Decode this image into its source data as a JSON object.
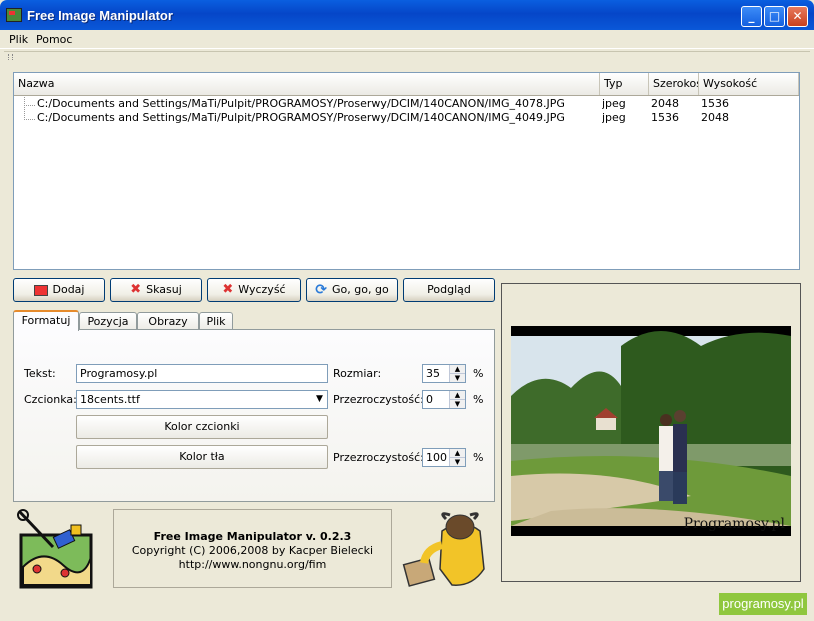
{
  "window": {
    "title": "Free Image Manipulator"
  },
  "menu": [
    "Plik",
    "Pomoc"
  ],
  "list": {
    "columns": [
      "Nazwa",
      "Typ",
      "Szerokość",
      "Wysokość"
    ],
    "rows": [
      {
        "name": "C:/Documents and Settings/MaTi/Pulpit/PROGRAMOSY/Proserwy/DCIM/140CANON/IMG_4078.JPG",
        "type": "jpeg",
        "width": "2048",
        "height": "1536"
      },
      {
        "name": "C:/Documents and Settings/MaTi/Pulpit/PROGRAMOSY/Proserwy/DCIM/140CANON/IMG_4049.JPG",
        "type": "jpeg",
        "width": "1536",
        "height": "2048"
      }
    ]
  },
  "buttons": {
    "add": "Dodaj",
    "delete": "Skasuj",
    "clear": "Wyczyść",
    "go": "Go, go, go",
    "preview": "Podgląd"
  },
  "tabs": [
    "Formatuj",
    "Pozycja",
    "Obrazy",
    "Plik"
  ],
  "format": {
    "text_label": "Tekst:",
    "text_value": "Programosy.pl",
    "font_label": "Czcionka:",
    "font_value": "18cents.ttf",
    "size_label": "Rozmiar:",
    "size_value": "35",
    "size_unit": "%",
    "font_opacity_label": "Przezroczystość:",
    "font_opacity_value": "0",
    "font_opacity_unit": "%",
    "font_color_button": "Kolor czcionki",
    "bg_color_button": "Kolor tła",
    "bg_opacity_label": "Przezroczystość:",
    "bg_opacity_value": "100",
    "bg_opacity_unit": "%"
  },
  "about": {
    "title": "Free Image Manipulator v. 0.2.3",
    "copyright": "Copyright (C) 2006,2008 by Kacper Bielecki",
    "url": "http://www.nongnu.org/fim"
  },
  "preview": {
    "watermark": "Programosy.pl"
  },
  "badge": "programosy.pl",
  "colors": {
    "titlebar": "#0546C8",
    "face": "#ECE9D8",
    "badge": "#8FC73E",
    "tab_accent": "#E68B2C"
  }
}
